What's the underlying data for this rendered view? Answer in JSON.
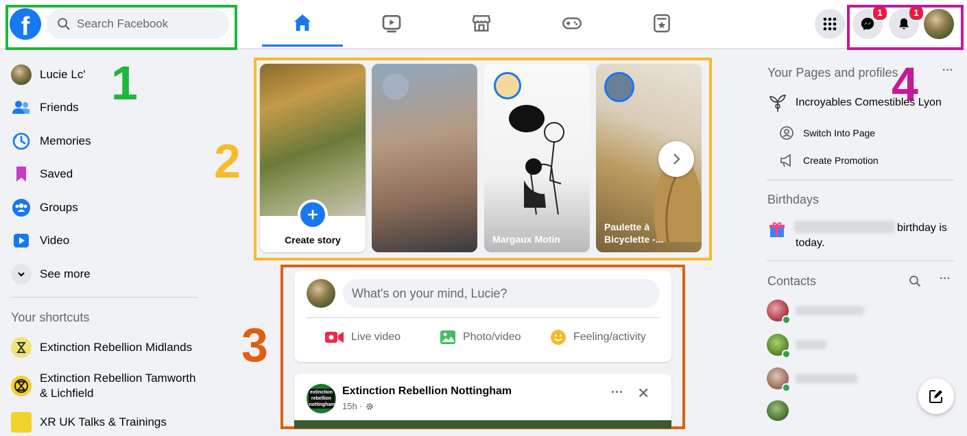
{
  "colors": {
    "facebook_blue": "#1877f2",
    "box1": "#1db83b",
    "box2": "#f7bb2b",
    "box3": "#e0600f",
    "box4": "#c8179a",
    "badge": "#e41e3f"
  },
  "header": {
    "logo": "f",
    "search_placeholder": "Search Facebook",
    "messenger_badge": "1",
    "notifications_badge": "1"
  },
  "nav_tabs": [
    {
      "icon": "home-icon",
      "active": true
    },
    {
      "icon": "watch-icon"
    },
    {
      "icon": "marketplace-icon"
    },
    {
      "icon": "gaming-icon"
    },
    {
      "icon": "news-icon"
    }
  ],
  "left": {
    "items": [
      {
        "label": "Lucie Lc'",
        "icon": "avatar"
      },
      {
        "label": "Friends",
        "icon": "friends-icon"
      },
      {
        "label": "Memories",
        "icon": "memories-icon"
      },
      {
        "label": "Saved",
        "icon": "saved-icon"
      },
      {
        "label": "Groups",
        "icon": "groups-icon"
      },
      {
        "label": "Video",
        "icon": "video-icon"
      },
      {
        "label": "See more",
        "icon": "chevron-down-icon"
      }
    ],
    "shortcuts_title": "Your shortcuts",
    "shortcuts": [
      {
        "label": "Extinction Rebellion Midlands"
      },
      {
        "label": "Extinction Rebellion Tamworth & Lichfield"
      },
      {
        "label": "XR UK Talks & Trainings"
      }
    ]
  },
  "stories": [
    {
      "label": "Create story"
    },
    {
      "label": ""
    },
    {
      "label": "Margaux Motin"
    },
    {
      "label": "Paulette à Bicyclette -..."
    }
  ],
  "composer": {
    "placeholder": "What's on your mind, Lucie?",
    "live": "Live video",
    "photo": "Photo/video",
    "feeling": "Feeling/activity"
  },
  "post": {
    "author": "Extinction Rebellion Nottingham",
    "time": "15h ·",
    "more": "···",
    "close": "✕",
    "logo_text": "extinction rebellion nottingham"
  },
  "right": {
    "pages_title": "Your Pages and profiles",
    "pages_more": "···",
    "page_name": "Incroyables Comestibles Lyon",
    "switch": "Switch Into Page",
    "promotion": "Create Promotion",
    "birthdays_title": "Birthdays",
    "birthday_text": "birthday is today.",
    "contacts_title": "Contacts",
    "contacts_more": "···"
  },
  "markers": {
    "m1": "1",
    "m2": "2",
    "m3": "3",
    "m4": "4"
  }
}
